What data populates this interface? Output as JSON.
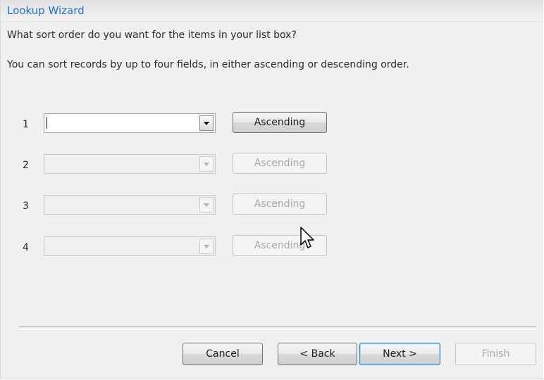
{
  "window": {
    "title": "Lookup Wizard"
  },
  "instructions": {
    "prompt": "What sort order do you want for the items in your list box?",
    "hint": "You can sort records by up to four fields, in either ascending or descending order."
  },
  "sort_rows": [
    {
      "number": "1",
      "field_value": "",
      "order_label": "Ascending",
      "enabled": true
    },
    {
      "number": "2",
      "field_value": "",
      "order_label": "Ascending",
      "enabled": false
    },
    {
      "number": "3",
      "field_value": "",
      "order_label": "Ascending",
      "enabled": false
    },
    {
      "number": "4",
      "field_value": "",
      "order_label": "Ascending",
      "enabled": false
    }
  ],
  "footer": {
    "cancel_label": "Cancel",
    "back_label": "< Back",
    "next_label": "Next >",
    "finish_label": "Finish"
  },
  "icons": {
    "dropdown": "chevron-down-icon",
    "cursor": "mouse-pointer-icon"
  }
}
